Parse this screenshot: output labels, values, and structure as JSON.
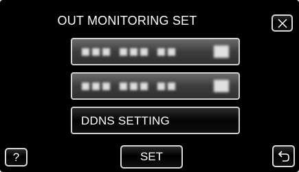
{
  "screen": {
    "title": "OUT MONITORING SET"
  },
  "buttons": {
    "close_icon": "close-icon",
    "help_label": "?",
    "set_label": "SET",
    "back_icon": "return-arrow-icon"
  },
  "menu": {
    "items": [
      {
        "state": "blurred",
        "label": ""
      },
      {
        "state": "blurred",
        "label": ""
      },
      {
        "state": "normal",
        "label": "DDNS SETTING"
      }
    ]
  },
  "colors": {
    "background": "#000000",
    "text": "#ffffff",
    "button_border": "#d8d8d8",
    "disabled_item": "#4a4a4a"
  }
}
